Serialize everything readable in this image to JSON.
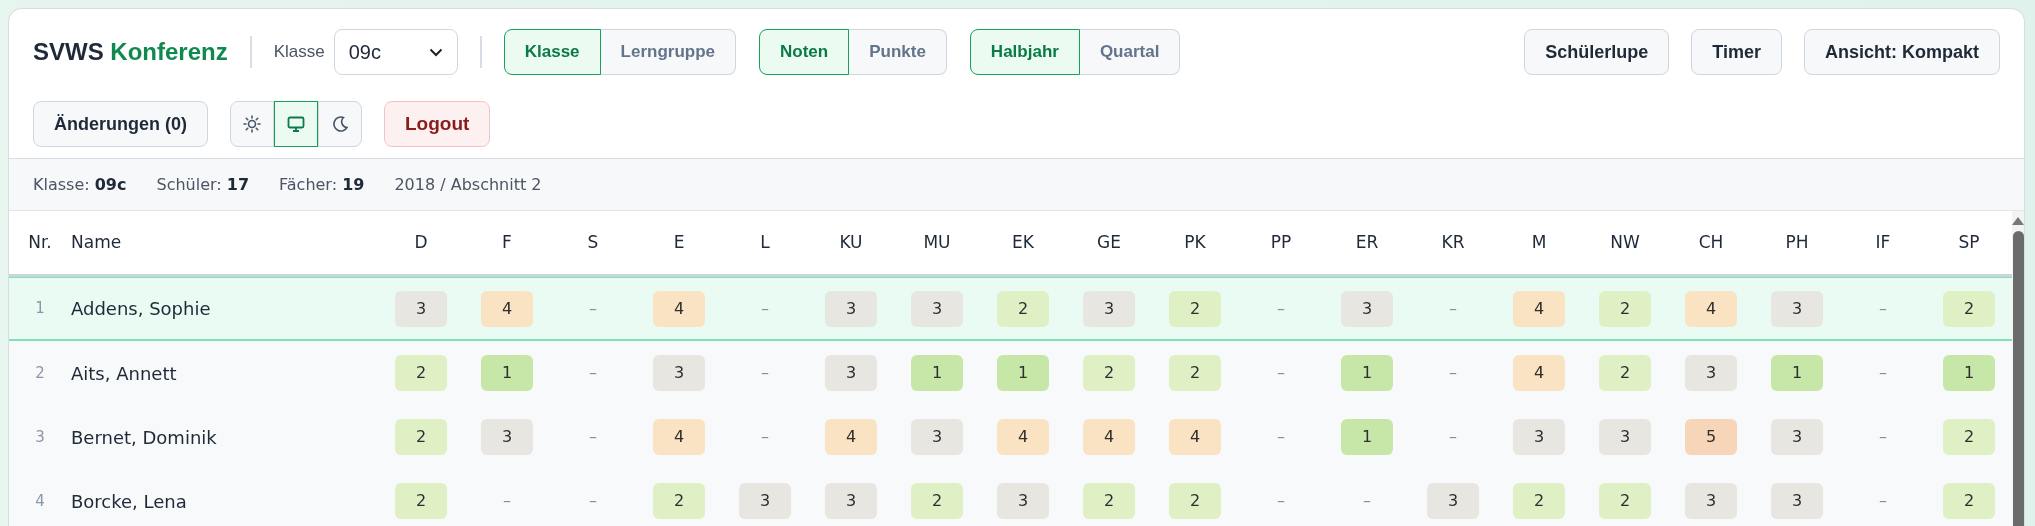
{
  "app_title": {
    "brand": "SVWS",
    "name": "Konferenz"
  },
  "class_select": {
    "label": "Klasse",
    "value": "09c"
  },
  "toggle_groups": [
    {
      "items": [
        {
          "label": "Klasse",
          "selected": true
        },
        {
          "label": "Lerngruppe",
          "selected": false
        }
      ]
    },
    {
      "items": [
        {
          "label": "Noten",
          "selected": true
        },
        {
          "label": "Punkte",
          "selected": false
        }
      ]
    },
    {
      "items": [
        {
          "label": "Halbjahr",
          "selected": true
        },
        {
          "label": "Quartal",
          "selected": false
        }
      ]
    }
  ],
  "right_buttons": [
    "Schülerlupe",
    "Timer",
    "Ansicht: Kompakt"
  ],
  "changes_button": "Änderungen (0)",
  "theme_buttons": [
    {
      "kind": "light",
      "selected": false
    },
    {
      "kind": "system",
      "selected": true
    },
    {
      "kind": "dark",
      "selected": false
    }
  ],
  "logout_button": "Logout",
  "info_bar": [
    "Klasse: **09c**",
    "Schüler: **17**",
    "Fächer: **19**",
    "2018 / Abschnitt 2"
  ],
  "table": {
    "columns": [
      "Nr.",
      "Name",
      "D",
      "F",
      "S",
      "E",
      "L",
      "KU",
      "MU",
      "EK",
      "GE",
      "PK",
      "PP",
      "ER",
      "KR",
      "M",
      "NW",
      "CH",
      "PH",
      "IF",
      "SP"
    ],
    "rows": [
      {
        "nr": "1",
        "name": "Addens, Sophie",
        "selected": true,
        "grades": [
          {
            "value": "3",
            "color": "#e8e6e0"
          },
          {
            "value": "4",
            "color": "#fae3c3"
          },
          {
            "value": "–"
          },
          {
            "value": "4",
            "color": "#fae3c3"
          },
          {
            "value": "–"
          },
          {
            "value": "3",
            "color": "#e8e6e0"
          },
          {
            "value": "3",
            "color": "#e8e6e0"
          },
          {
            "value": "2",
            "color": "#dff0c5"
          },
          {
            "value": "3",
            "color": "#e8e6e0"
          },
          {
            "value": "2",
            "color": "#dff0c5"
          },
          {
            "value": "–"
          },
          {
            "value": "3",
            "color": "#e8e6e0"
          },
          {
            "value": "–"
          },
          {
            "value": "4",
            "color": "#fae3c3"
          },
          {
            "value": "2",
            "color": "#dff0c5"
          },
          {
            "value": "4",
            "color": "#fae3c3"
          },
          {
            "value": "3",
            "color": "#e8e6e0"
          },
          {
            "value": "–"
          },
          {
            "value": "2",
            "color": "#dff0c5"
          }
        ]
      },
      {
        "nr": "2",
        "name": "Aits, Annett",
        "selected": false,
        "grades": [
          {
            "value": "2",
            "color": "#dff0c5"
          },
          {
            "value": "1",
            "color": "#c6e7a8"
          },
          {
            "value": "–"
          },
          {
            "value": "3",
            "color": "#e8e6e0"
          },
          {
            "value": "–"
          },
          {
            "value": "3",
            "color": "#e8e6e0"
          },
          {
            "value": "1",
            "color": "#c6e7a8"
          },
          {
            "value": "1",
            "color": "#c6e7a8"
          },
          {
            "value": "2",
            "color": "#dff0c5"
          },
          {
            "value": "2",
            "color": "#dff0c5"
          },
          {
            "value": "–"
          },
          {
            "value": "1",
            "color": "#c6e7a8"
          },
          {
            "value": "–"
          },
          {
            "value": "4",
            "color": "#fae3c3"
          },
          {
            "value": "2",
            "color": "#dff0c5"
          },
          {
            "value": "3",
            "color": "#e8e6e0"
          },
          {
            "value": "1",
            "color": "#c6e7a8"
          },
          {
            "value": "–"
          },
          {
            "value": "1",
            "color": "#c6e7a8"
          }
        ]
      },
      {
        "nr": "3",
        "name": "Bernet, Dominik",
        "selected": false,
        "grades": [
          {
            "value": "2",
            "color": "#dff0c5"
          },
          {
            "value": "3",
            "color": "#e8e6e0"
          },
          {
            "value": "–"
          },
          {
            "value": "4",
            "color": "#fae3c3"
          },
          {
            "value": "–"
          },
          {
            "value": "4",
            "color": "#fae3c3"
          },
          {
            "value": "3",
            "color": "#e8e6e0"
          },
          {
            "value": "4",
            "color": "#fae3c3"
          },
          {
            "value": "4",
            "color": "#fae3c3"
          },
          {
            "value": "4",
            "color": "#fae3c3"
          },
          {
            "value": "–"
          },
          {
            "value": "1",
            "color": "#c6e7a8"
          },
          {
            "value": "–"
          },
          {
            "value": "3",
            "color": "#e8e6e0"
          },
          {
            "value": "3",
            "color": "#e8e6e0"
          },
          {
            "value": "5",
            "color": "#f7d5b8"
          },
          {
            "value": "3",
            "color": "#e8e6e0"
          },
          {
            "value": "–"
          },
          {
            "value": "2",
            "color": "#dff0c5"
          }
        ]
      },
      {
        "nr": "4",
        "name": "Borcke, Lena",
        "selected": false,
        "grades": [
          {
            "value": "2",
            "color": "#dff0c5"
          },
          {
            "value": "–"
          },
          {
            "value": "–"
          },
          {
            "value": "2",
            "color": "#dff0c5"
          },
          {
            "value": "3",
            "color": "#e8e6e0"
          },
          {
            "value": "3",
            "color": "#e8e6e0"
          },
          {
            "value": "2",
            "color": "#dff0c5"
          },
          {
            "value": "3",
            "color": "#e8e6e0"
          },
          {
            "value": "2",
            "color": "#dff0c5"
          },
          {
            "value": "2",
            "color": "#dff0c5"
          },
          {
            "value": "–"
          },
          {
            "value": "–"
          },
          {
            "value": "3",
            "color": "#e8e6e0"
          },
          {
            "value": "2",
            "color": "#dff0c5"
          },
          {
            "value": "2",
            "color": "#dff0c5"
          },
          {
            "value": "3",
            "color": "#e8e6e0"
          },
          {
            "value": "3",
            "color": "#e8e6e0"
          },
          {
            "value": "–"
          },
          {
            "value": "2",
            "color": "#dff0c5"
          }
        ]
      }
    ]
  }
}
